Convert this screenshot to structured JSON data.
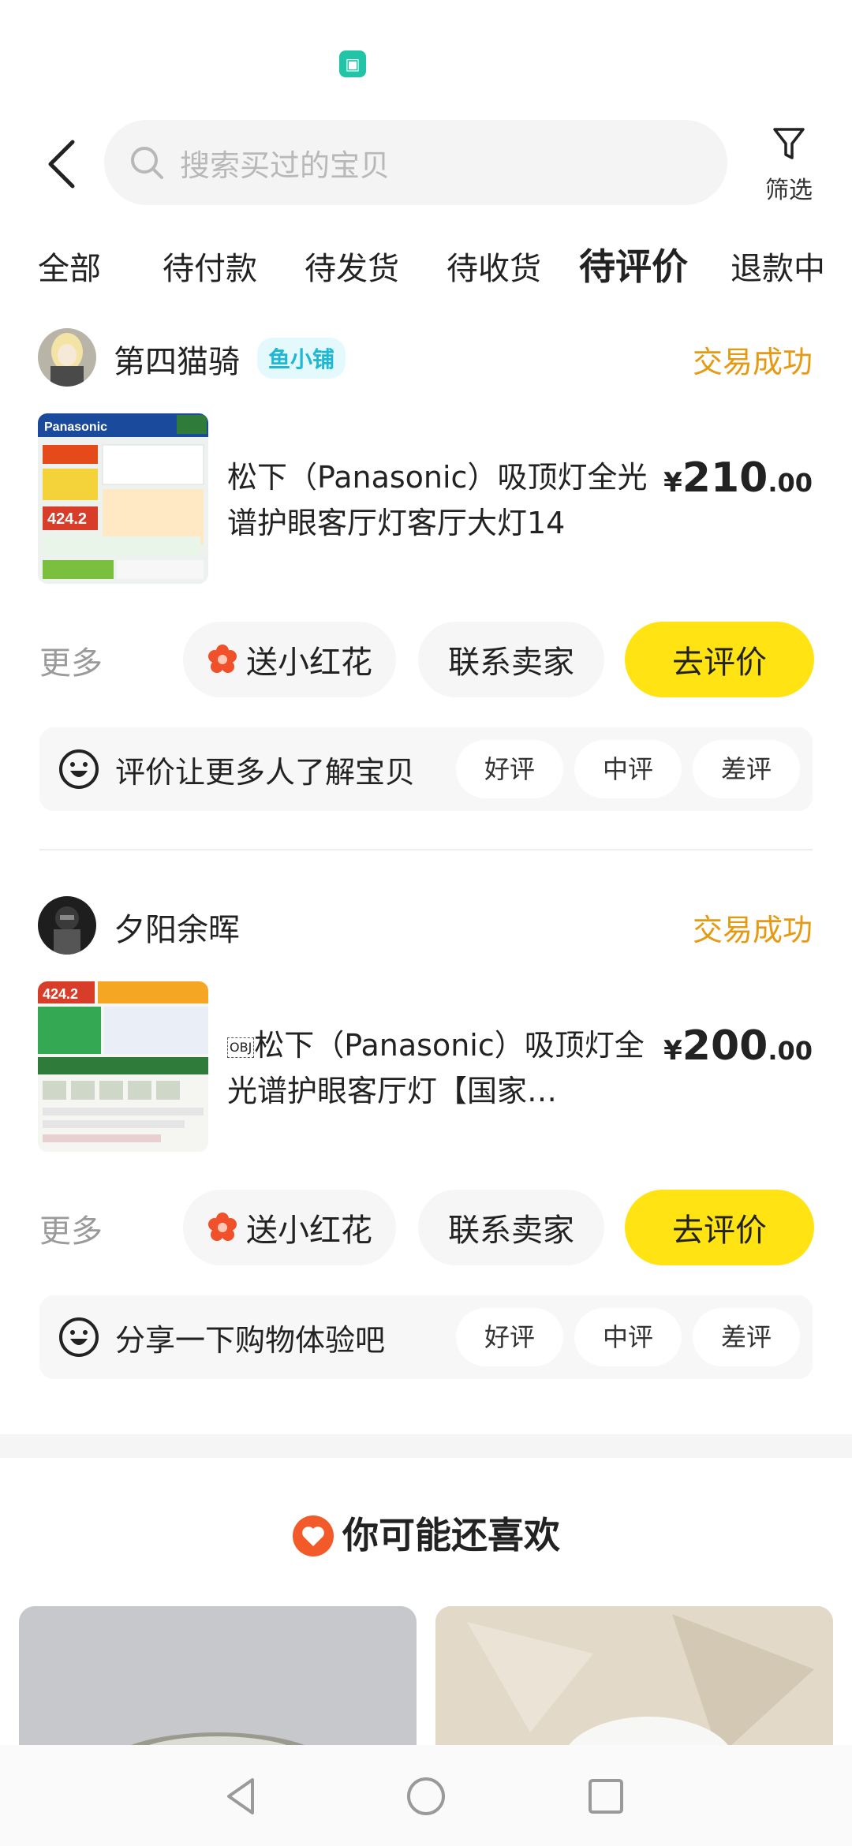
{
  "header": {
    "search_placeholder": "搜索买过的宝贝",
    "filter_label": "筛选"
  },
  "tabs": [
    {
      "label": "全部"
    },
    {
      "label": "待付款"
    },
    {
      "label": "待发货"
    },
    {
      "label": "待收货"
    },
    {
      "label": "待评价",
      "active": true
    },
    {
      "label": "退款中"
    }
  ],
  "orders": [
    {
      "seller": "第四猫骑",
      "shop_tag": "鱼小铺",
      "status": "交易成功",
      "title": "松下（Panasonic）吸顶灯全光谱护眼客厅灯客厅大灯14",
      "price_currency": "¥",
      "price_int": "210",
      "price_dec": ".00",
      "more": "更多",
      "flower_label": "送小红花",
      "contact_label": "联系卖家",
      "review_label": "去评价",
      "review_prompt": "评价让更多人了解宝贝",
      "ratings": [
        "好评",
        "中评",
        "差评"
      ]
    },
    {
      "seller": "夕阳余晖",
      "status": "交易成功",
      "title": "松下（Panasonic）吸顶灯全光谱护眼客厅灯【国家…",
      "price_currency": "¥",
      "price_int": "200",
      "price_dec": ".00",
      "more": "更多",
      "flower_label": "送小红花",
      "contact_label": "联系卖家",
      "review_label": "去评价",
      "review_prompt": "分享一下购物体验吧",
      "ratings": [
        "好评",
        "中评",
        "差评"
      ]
    }
  ],
  "recommend": {
    "title": "你可能还喜欢"
  },
  "colors": {
    "accent_yellow": "#ffe312",
    "status_orange": "#e59a12",
    "shop_tag_blue": "#1fb8d4"
  }
}
